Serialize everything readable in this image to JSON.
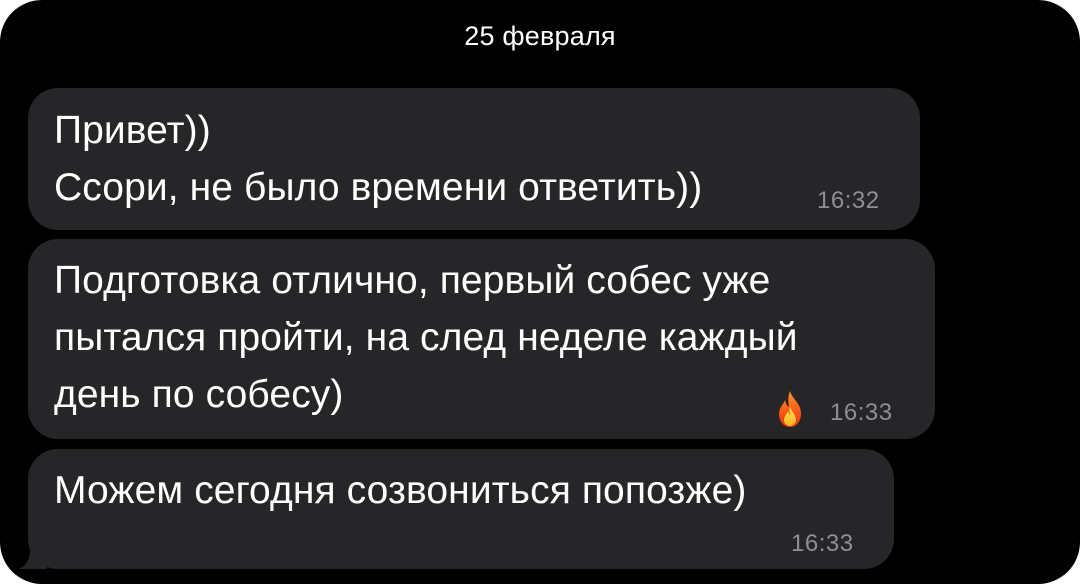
{
  "chat": {
    "date_header": "25 февраля",
    "messages": [
      {
        "text": "Привет))\nСсори, не было времени ответить))",
        "time": "16:32"
      },
      {
        "text": "Подготовка отлично, первый собес уже\nпытался пройти, на след неделе каждый\nдень по собесу)",
        "time": "16:33",
        "reaction": "fire-icon"
      },
      {
        "text": "Можем сегодня созвониться попозже)",
        "time": "16:33"
      }
    ]
  },
  "colors": {
    "background": "#000000",
    "bubble": "#262628",
    "text": "#ffffff",
    "timestamp": "#8e8e93"
  }
}
